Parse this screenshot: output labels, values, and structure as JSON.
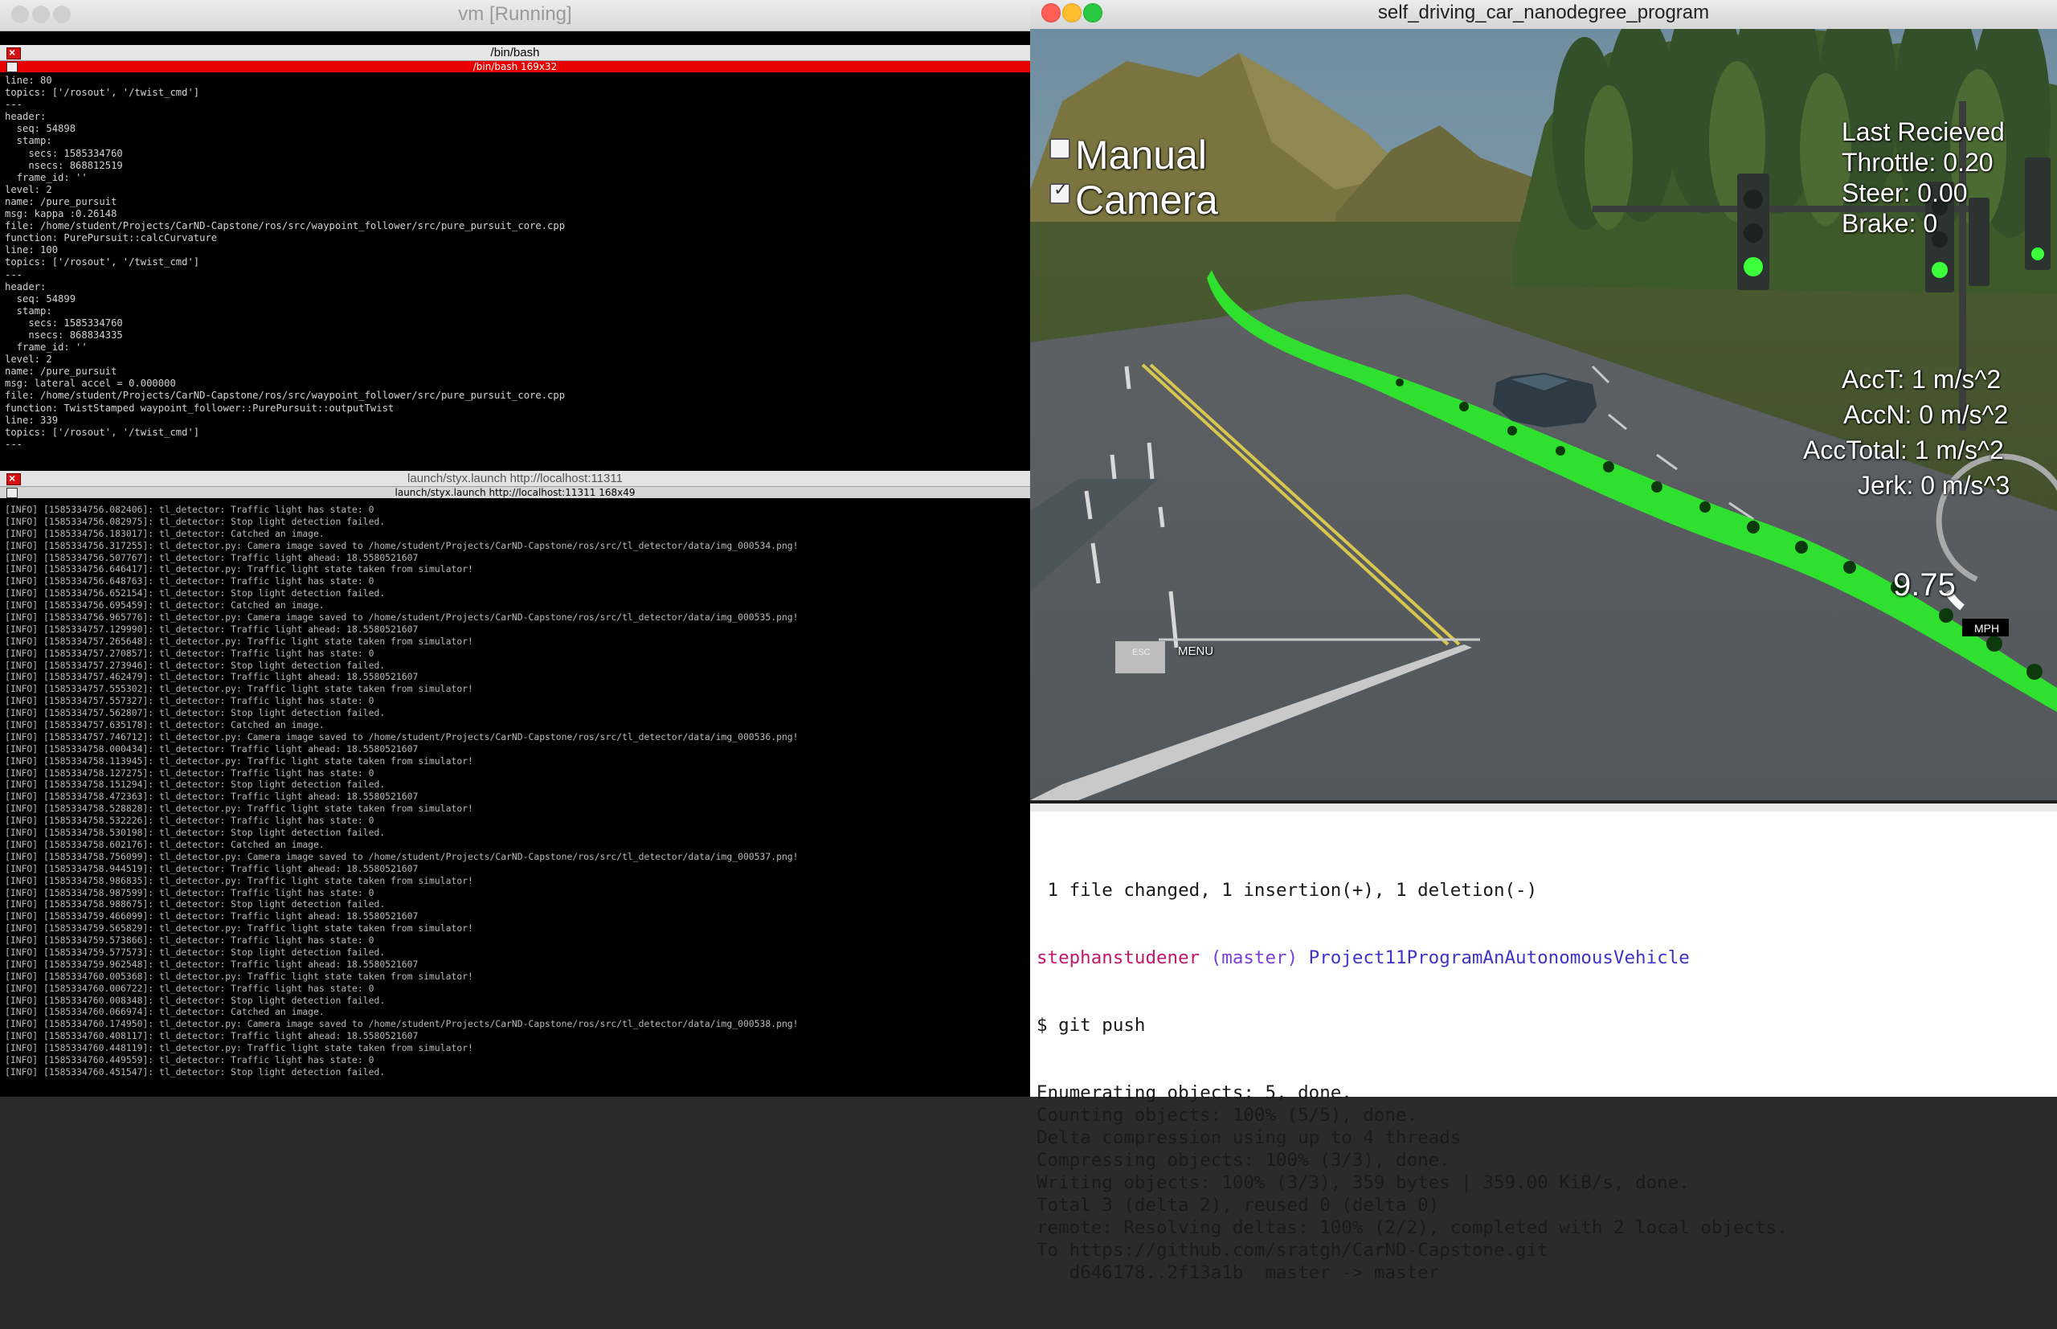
{
  "colors": {
    "prompt_user": "#c0186b",
    "prompt_branch": "#7a40d6",
    "prompt_dir": "#3f34c9",
    "green_path": "#2fe02f",
    "close_red": "#ff5f57",
    "min_yellow": "#febc2e",
    "max_green": "#28c840"
  },
  "vm": {
    "title": "vm [Running]",
    "term1": {
      "title": "/bin/bash",
      "subtitle": "/bin/bash 169x32",
      "lines": [
        "line: 80",
        "topics: ['/rosout', '/twist_cmd']",
        "---",
        "header:",
        "  seq: 54898",
        "  stamp:",
        "    secs: 1585334760",
        "    nsecs: 868812519",
        "  frame_id: ''",
        "level: 2",
        "name: /pure_pursuit",
        "msg: kappa :0.26148",
        "file: /home/student/Projects/CarND-Capstone/ros/src/waypoint_follower/src/pure_pursuit_core.cpp",
        "function: PurePursuit::calcCurvature",
        "line: 100",
        "topics: ['/rosout', '/twist_cmd']",
        "---",
        "header:",
        "  seq: 54899",
        "  stamp:",
        "    secs: 1585334760",
        "    nsecs: 868834335",
        "  frame_id: ''",
        "level: 2",
        "name: /pure_pursuit",
        "msg: lateral accel = 0.000000",
        "file: /home/student/Projects/CarND-Capstone/ros/src/waypoint_follower/src/pure_pursuit_core.cpp",
        "function: TwistStamped waypoint_follower::PurePursuit::outputTwist",
        "line: 339",
        "topics: ['/rosout', '/twist_cmd']",
        "---"
      ]
    },
    "term2": {
      "title": "launch/styx.launch http://localhost:11311",
      "subtitle": "launch/styx.launch http://localhost:11311 168x49",
      "lines": [
        "[INFO] [1585334756.082406]: tl_detector: Traffic light has state: 0",
        "[INFO] [1585334756.082975]: tl_detector: Stop light detection failed.",
        "[INFO] [1585334756.183017]: tl_detector: Catched an image.",
        "[INFO] [1585334756.317255]: tl_detector.py: Camera image saved to /home/student/Projects/CarND-Capstone/ros/src/tl_detector/data/img_000534.png!",
        "[INFO] [1585334756.507767]: tl_detector: Traffic light ahead: 18.5580521607",
        "[INFO] [1585334756.646417]: tl_detector.py: Traffic light state taken from simulator!",
        "[INFO] [1585334756.648763]: tl_detector: Traffic light has state: 0",
        "[INFO] [1585334756.652154]: tl_detector: Stop light detection failed.",
        "[INFO] [1585334756.695459]: tl_detector: Catched an image.",
        "[INFO] [1585334756.965776]: tl_detector.py: Camera image saved to /home/student/Projects/CarND-Capstone/ros/src/tl_detector/data/img_000535.png!",
        "[INFO] [1585334757.129990]: tl_detector: Traffic light ahead: 18.5580521607",
        "[INFO] [1585334757.265648]: tl_detector.py: Traffic light state taken from simulator!",
        "[INFO] [1585334757.270857]: tl_detector: Traffic light has state: 0",
        "[INFO] [1585334757.273946]: tl_detector: Stop light detection failed.",
        "[INFO] [1585334757.462479]: tl_detector: Traffic light ahead: 18.5580521607",
        "[INFO] [1585334757.555302]: tl_detector.py: Traffic light state taken from simulator!",
        "[INFO] [1585334757.557327]: tl_detector: Traffic light has state: 0",
        "[INFO] [1585334757.562807]: tl_detector: Stop light detection failed.",
        "[INFO] [1585334757.635178]: tl_detector: Catched an image.",
        "[INFO] [1585334757.746712]: tl_detector.py: Camera image saved to /home/student/Projects/CarND-Capstone/ros/src/tl_detector/data/img_000536.png!",
        "[INFO] [1585334758.000434]: tl_detector: Traffic light ahead: 18.5580521607",
        "[INFO] [1585334758.113945]: tl_detector.py: Traffic light state taken from simulator!",
        "[INFO] [1585334758.127275]: tl_detector: Traffic light has state: 0",
        "[INFO] [1585334758.151294]: tl_detector: Stop light detection failed.",
        "[INFO] [1585334758.472363]: tl_detector: Traffic light ahead: 18.5580521607",
        "[INFO] [1585334758.528828]: tl_detector.py: Traffic light state taken from simulator!",
        "[INFO] [1585334758.532226]: tl_detector: Traffic light has state: 0",
        "[INFO] [1585334758.530198]: tl_detector: Stop light detection failed.",
        "[INFO] [1585334758.602176]: tl_detector: Catched an image.",
        "[INFO] [1585334758.756099]: tl_detector.py: Camera image saved to /home/student/Projects/CarND-Capstone/ros/src/tl_detector/data/img_000537.png!",
        "[INFO] [1585334758.944519]: tl_detector: Traffic light ahead: 18.5580521607",
        "[INFO] [1585334758.986835]: tl_detector.py: Traffic light state taken from simulator!",
        "[INFO] [1585334758.987599]: tl_detector: Traffic light has state: 0",
        "[INFO] [1585334758.988675]: tl_detector: Stop light detection failed.",
        "[INFO] [1585334759.466099]: tl_detector: Traffic light ahead: 18.5580521607",
        "[INFO] [1585334759.565829]: tl_detector.py: Traffic light state taken from simulator!",
        "[INFO] [1585334759.573866]: tl_detector: Traffic light has state: 0",
        "[INFO] [1585334759.577573]: tl_detector: Stop light detection failed.",
        "[INFO] [1585334759.962548]: tl_detector: Traffic light ahead: 18.5580521607",
        "[INFO] [1585334760.005368]: tl_detector.py: Traffic light state taken from simulator!",
        "[INFO] [1585334760.006722]: tl_detector: Traffic light has state: 0",
        "[INFO] [1585334760.008348]: tl_detector: Stop light detection failed.",
        "[INFO] [1585334760.066974]: tl_detector: Catched an image.",
        "[INFO] [1585334760.174950]: tl_detector.py: Camera image saved to /home/student/Projects/CarND-Capstone/ros/src/tl_detector/data/img_000538.png!",
        "[INFO] [1585334760.408117]: tl_detector: Traffic light ahead: 18.5580521607",
        "[INFO] [1585334760.448119]: tl_detector.py: Traffic light state taken from simulator!",
        "[INFO] [1585334760.449559]: tl_detector: Traffic light has state: 0",
        "[INFO] [1585334760.451547]: tl_detector: Stop light detection failed."
      ]
    }
  },
  "simulator": {
    "title": "self_driving_car_nanodegree_program",
    "manual_label": "Manual",
    "manual_checked": false,
    "camera_label": "Camera",
    "camera_checked": true,
    "last_received": "Last Recieved",
    "throttle": "Throttle: 0.20",
    "steer": "Steer: 0.00",
    "brake": "Brake: 0",
    "acct": "AccT: 1 m/s^2",
    "accn": "AccN: 0 m/s^2",
    "acctotal": "AccTotal: 1 m/s^2",
    "jerk": "Jerk: 0 m/s^3",
    "speed": "9.75",
    "speed_unit": "MPH",
    "esc_label": "ESC",
    "menu_label": "MENU"
  },
  "mac_terminal": {
    "summary": " 1 file changed, 1 insertion(+), 1 deletion(-)",
    "prompt_user": "stephanstudener",
    "prompt_branch": "(master)",
    "prompt_dir": "Project11ProgramAnAutonomousVehicle",
    "command": "$ git push",
    "output": [
      "Enumerating objects: 5, done.",
      "Counting objects: 100% (5/5), done.",
      "Delta compression using up to 4 threads",
      "Compressing objects: 100% (3/3), done.",
      "Writing objects: 100% (3/3), 359 bytes | 359.00 KiB/s, done.",
      "Total 3 (delta 2), reused 0 (delta 0)",
      "remote: Resolving deltas: 100% (2/2), completed with 2 local objects.",
      "To https://github.com/sratgh/CarND-Capstone.git",
      "   d646178..2f13a1b  master -> master"
    ]
  }
}
